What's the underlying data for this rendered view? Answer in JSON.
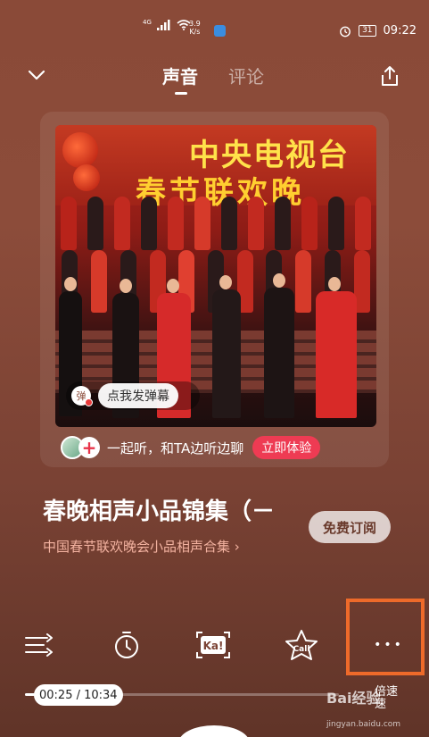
{
  "status_bar": {
    "network": "4G",
    "net_speed_value": "3.9",
    "net_speed_unit": "K/s",
    "battery": "31",
    "time": "09:22"
  },
  "nav": {
    "tab_active": "声音",
    "tab_inactive": "评论"
  },
  "cover": {
    "banner_line1": "中央电视台",
    "banner_line2": "春节联欢晚"
  },
  "danmu": {
    "icon_text": "弹",
    "label": "点我发弹幕"
  },
  "listen_together": {
    "plus": "+",
    "text": "一起听，和TA边听边聊",
    "button": "立即体验"
  },
  "track": {
    "title": "春晚相声小品锦集（－",
    "album": "中国春节联欢晚会小品相声合集",
    "album_arrow": "›",
    "subscribe": "免费订阅"
  },
  "controls": {
    "ka_label": "Ka!",
    "call_label": "Call",
    "more_label": "•••"
  },
  "progress": {
    "current": "00:25",
    "total": "10:34",
    "display": "00:25 / 10:34",
    "fraction": 0.04
  },
  "speed": {
    "line1": "倍速",
    "line2": "速"
  },
  "watermark": {
    "text": "Bai经验",
    "url": "jingyan.baidu.com"
  },
  "colors": {
    "accent_red": "#ee3b53",
    "highlight_orange": "#ee6a2a"
  }
}
